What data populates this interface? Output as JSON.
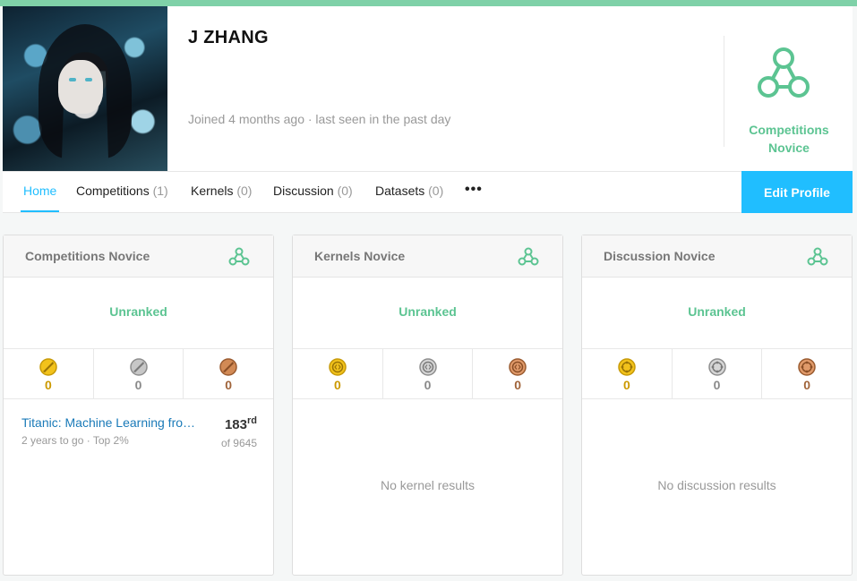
{
  "colors": {
    "accent_green": "#5cc492",
    "accent_blue": "#20beff",
    "link_blue": "#1a7ab8",
    "gold": "#cc9900",
    "silver": "#8a8a8a",
    "bronze": "#a0643a"
  },
  "profile": {
    "name": "J ZHANG",
    "meta": "Joined 4 months ago · last seen in the past day",
    "tier_icon": "novice-tier-icon",
    "tier_line1": "Competitions",
    "tier_line2": "Novice"
  },
  "nav": {
    "items": [
      {
        "label": "Home",
        "count": ""
      },
      {
        "label": "Competitions",
        "count": "(1)"
      },
      {
        "label": "Kernels",
        "count": "(0)"
      },
      {
        "label": "Discussion",
        "count": "(0)"
      },
      {
        "label": "Datasets",
        "count": "(0)"
      }
    ],
    "more": "•••",
    "edit_button": "Edit Profile"
  },
  "cards": [
    {
      "title": "Competitions Novice",
      "rank": "Unranked",
      "medals": [
        "0",
        "0",
        "0"
      ],
      "medal_icons": [
        "gold-medal-icon",
        "silver-medal-icon",
        "bronze-medal-icon"
      ],
      "entry": {
        "title": "Titanic: Machine Learning from Disaster",
        "subtitle": "2 years to go · Top 2%",
        "rank": "183",
        "rank_suffix": "rd",
        "of": "of 9645"
      }
    },
    {
      "title": "Kernels Novice",
      "rank": "Unranked",
      "medals": [
        "0",
        "0",
        "0"
      ],
      "medal_icons": [
        "gold-kernel-medal-icon",
        "silver-kernel-medal-icon",
        "bronze-kernel-medal-icon"
      ],
      "empty": "No kernel results"
    },
    {
      "title": "Discussion Novice",
      "rank": "Unranked",
      "medals": [
        "0",
        "0",
        "0"
      ],
      "medal_icons": [
        "gold-discussion-medal-icon",
        "silver-discussion-medal-icon",
        "bronze-discussion-medal-icon"
      ],
      "empty": "No discussion results"
    }
  ]
}
